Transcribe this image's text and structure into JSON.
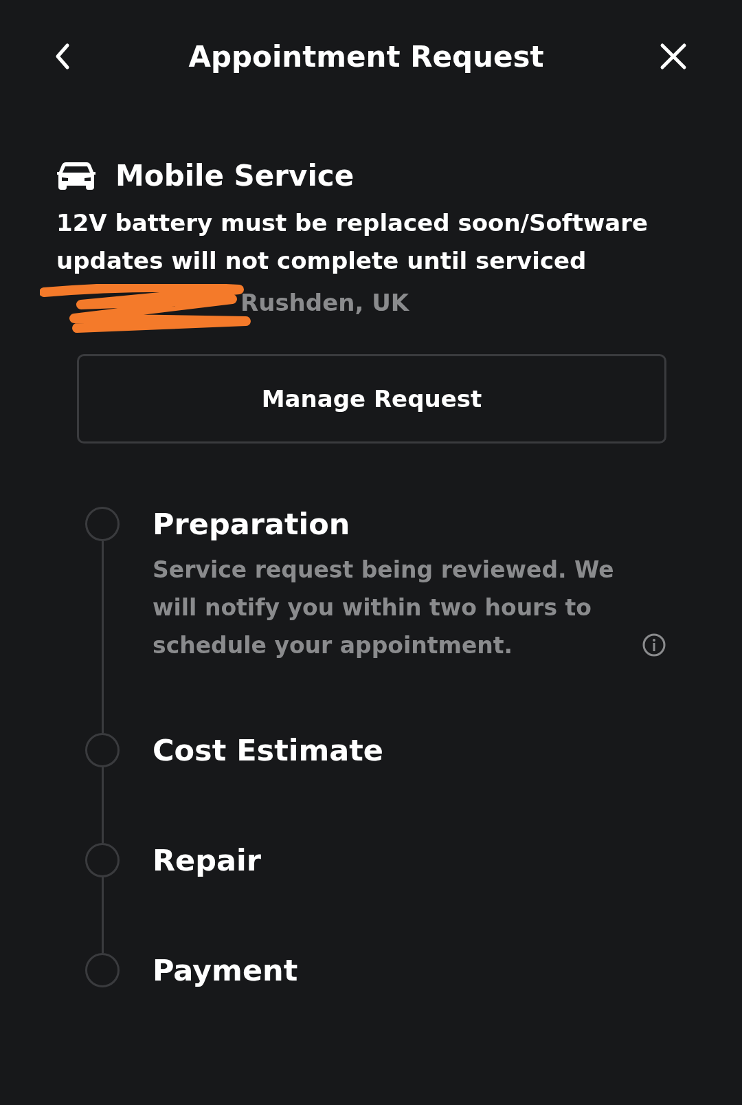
{
  "header": {
    "title": "Appointment Request"
  },
  "service": {
    "title": "Mobile Service",
    "description": "12V battery must be replaced soon/Software updates will not complete until serviced",
    "address": "Rushden, UK"
  },
  "manage_button": {
    "label": "Manage Request"
  },
  "steps": [
    {
      "title": "Preparation",
      "description": "Service request being reviewed. We will notify you within two hours to schedule your appointment.",
      "info": true
    },
    {
      "title": "Cost Estimate"
    },
    {
      "title": "Repair"
    },
    {
      "title": "Payment"
    }
  ]
}
